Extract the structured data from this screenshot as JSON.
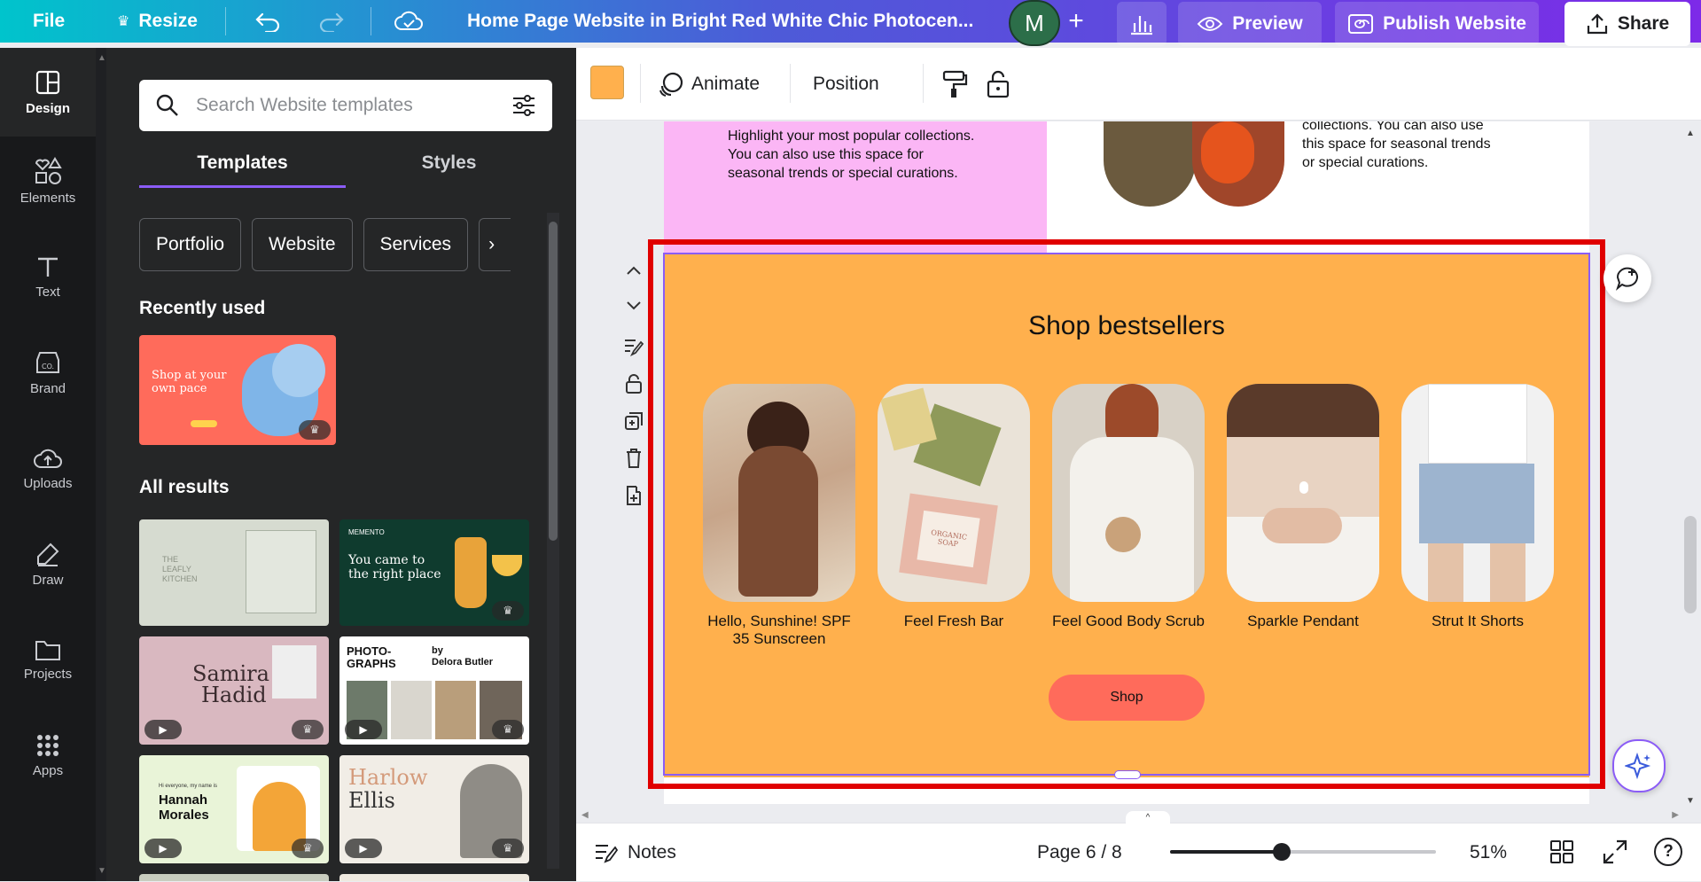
{
  "topbar": {
    "file": "File",
    "resize": "Resize",
    "title": "Home Page Website in Bright Red White Chic Photocen...",
    "avatar_initial": "M",
    "preview": "Preview",
    "publish": "Publish Website",
    "share": "Share"
  },
  "sidebar": {
    "items": [
      {
        "label": "Design"
      },
      {
        "label": "Elements"
      },
      {
        "label": "Text"
      },
      {
        "label": "Brand"
      },
      {
        "label": "Uploads"
      },
      {
        "label": "Draw"
      },
      {
        "label": "Projects"
      },
      {
        "label": "Apps"
      }
    ]
  },
  "panel": {
    "search_placeholder": "Search Website templates",
    "tabs": [
      "Templates",
      "Styles"
    ],
    "chips": [
      "Portfolio",
      "Website",
      "Services"
    ],
    "recently_used": "Recently used",
    "all_results": "All results",
    "recent_thumb": {
      "line1": "Shop at your",
      "line2": "own pace"
    },
    "thumbs": {
      "memento": {
        "brand": "MEMENTO",
        "line1": "You came to",
        "line2": "the right place"
      },
      "samira": {
        "line1": "Samira",
        "line2": "Hadid"
      },
      "photographs": {
        "line1": "PHOTO-",
        "line2": "GRAPHS",
        "by": "by",
        "author": "Delora Butler"
      },
      "hannah": {
        "greeting": "Hi everyone, my name is",
        "line1": "Hannah",
        "line2": "Morales"
      },
      "harlow": {
        "line1": "Harlow",
        "line2": "Ellis"
      },
      "leafly": {
        "line1": "THE",
        "line2": "LEAFLY",
        "line3": "KITCHEN"
      }
    }
  },
  "toolbar": {
    "color_swatch": "#ffb04d",
    "animate": "Animate",
    "position": "Position"
  },
  "canvas": {
    "pink_text": "Highlight your most popular collections. You can also use this space for seasonal trends or special curations.",
    "right_text": "collections. You can also use this space for seasonal trends or special curations.",
    "section_title": "Shop bestsellers",
    "products": [
      {
        "name": "Hello, Sunshine! SPF 35 Sunscreen"
      },
      {
        "name": "Feel Fresh Bar"
      },
      {
        "name": "Feel Good Body Scrub"
      },
      {
        "name": "Sparkle Pendant"
      },
      {
        "name": "Strut It Shorts"
      }
    ],
    "shop_button": "Shop",
    "soap_label": "ORGANIC SOAP"
  },
  "bottombar": {
    "notes": "Notes",
    "page": "Page 6 / 8",
    "zoom": "51%"
  },
  "colors": {
    "orange": "#ffb04d",
    "pink": "#fbb6f5",
    "shop_button": "#ff6b5b",
    "selection": "#e00000",
    "accent": "#8b5cf6"
  }
}
